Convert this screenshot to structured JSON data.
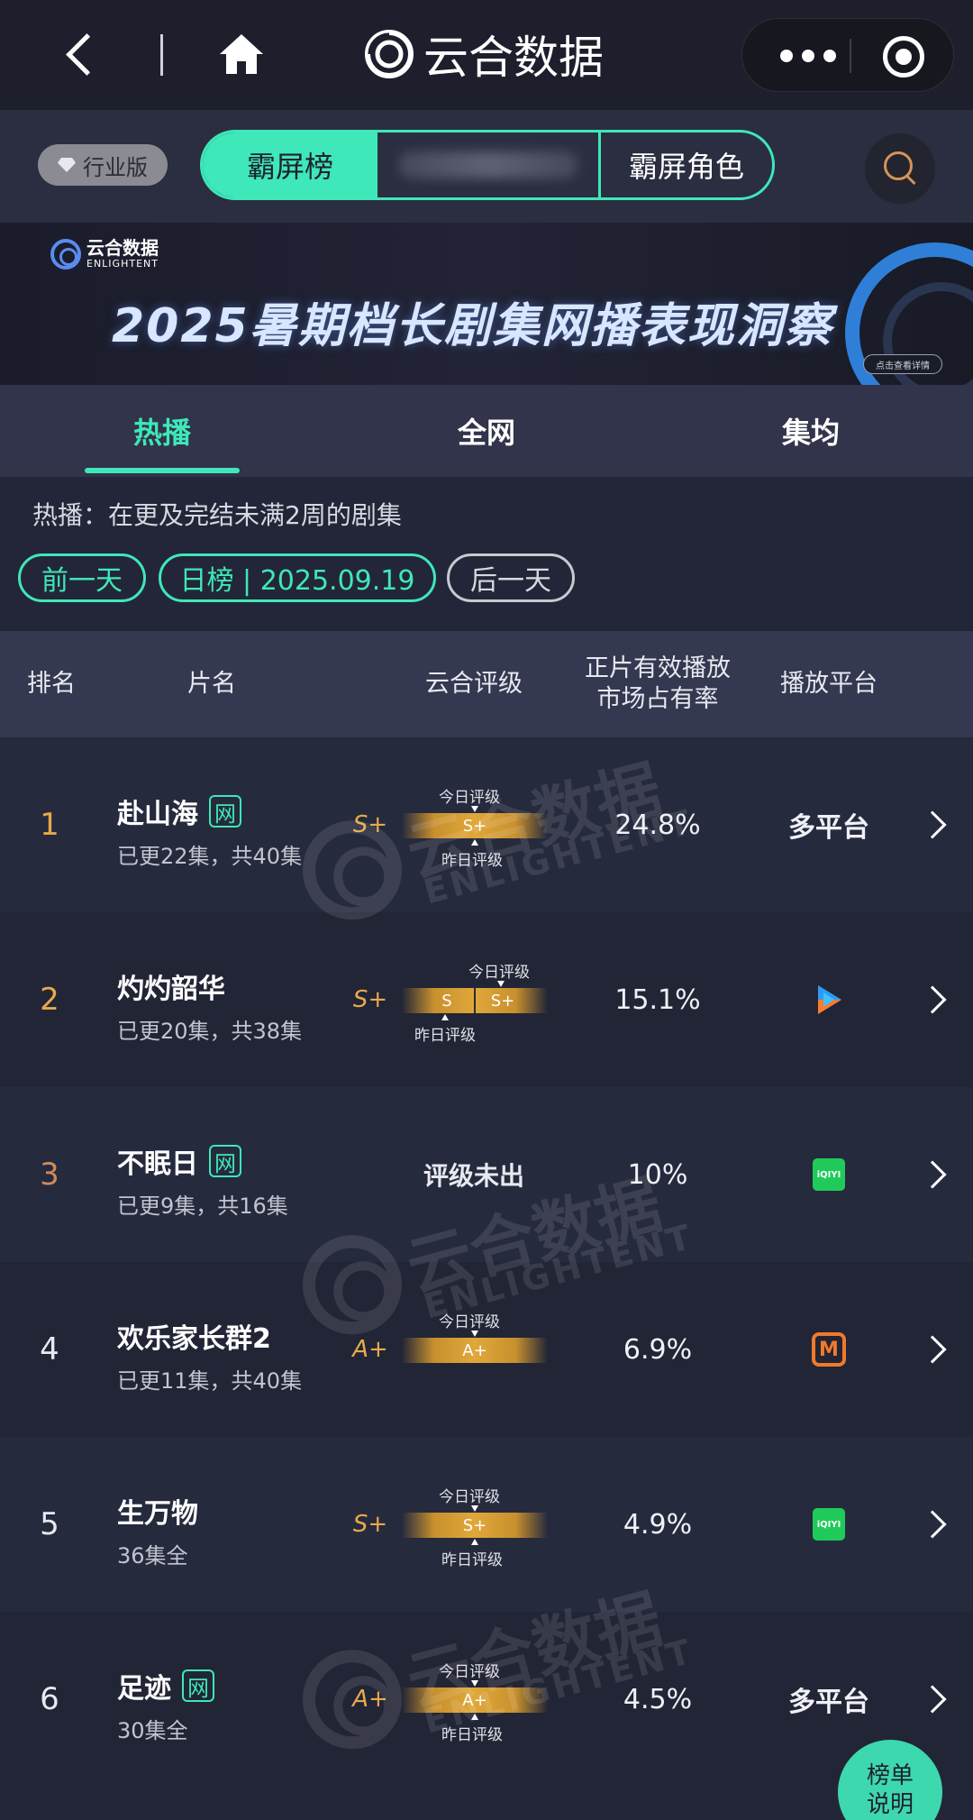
{
  "nav": {
    "title": "云合数据",
    "icons": [
      "back-icon",
      "home-icon",
      "more-icon",
      "close-icon"
    ]
  },
  "subhead": {
    "edition": "行业版",
    "segments": [
      "霸屏榜",
      "",
      "霸屏角色"
    ],
    "search_icon": "search-icon"
  },
  "banner": {
    "logo_text": "云合数据",
    "logo_sub": "ENLIGHTENT",
    "title": "2025暑期档长剧集网播表现洞察",
    "cta": "点击查看详情"
  },
  "tabs": [
    "热播",
    "全网",
    "集均"
  ],
  "description": "热播：在更及完结未满2周的剧集",
  "dates": {
    "prev": "前一天",
    "current": "日榜 | 2025.09.19",
    "next": "后一天"
  },
  "table": {
    "headers": [
      "排名",
      "片名",
      "云合评级",
      "正片有效播放\n市场占有率",
      "播放平台"
    ],
    "rows": [
      {
        "rank": "1",
        "title": "赴山海",
        "tag": "网",
        "episodes": "已更22集，共40集",
        "grade": "S+",
        "today_label": "今日评级",
        "yesterday_label": "昨日评级",
        "today": "S+",
        "yesterday": "",
        "share": "24.8%",
        "platform": "多平台",
        "platform_icon": ""
      },
      {
        "rank": "2",
        "title": "灼灼韶华",
        "tag": "",
        "episodes": "已更20集，共38集",
        "grade": "S+",
        "today_label": "今日评级",
        "yesterday_label": "昨日评级",
        "today": "S+",
        "yesterday": "S",
        "share": "15.1%",
        "platform": "",
        "platform_icon": "tencent-video-icon"
      },
      {
        "rank": "3",
        "title": "不眠日",
        "tag": "网",
        "episodes": "已更9集，共16集",
        "grade": "",
        "no_grade": "评级未出",
        "share": "10%",
        "platform": "",
        "platform_icon": "iqiyi-icon"
      },
      {
        "rank": "4",
        "title": "欢乐家长群2",
        "tag": "",
        "episodes": "已更11集，共40集",
        "grade": "A+",
        "today_label": "今日评级",
        "today": "A+",
        "share": "6.9%",
        "platform": "",
        "platform_icon": "mango-tv-icon"
      },
      {
        "rank": "5",
        "title": "生万物",
        "tag": "",
        "episodes": "36集全",
        "grade": "S+",
        "today_label": "今日评级",
        "yesterday_label": "昨日评级",
        "today": "S+",
        "share": "4.9%",
        "platform": "",
        "platform_icon": "iqiyi-icon"
      },
      {
        "rank": "6",
        "title": "足迹",
        "tag": "网",
        "episodes": "30集全",
        "grade": "A+",
        "today_label": "今日评级",
        "yesterday_label": "昨日评级",
        "today": "A+",
        "share": "4.5%",
        "platform": "多平台",
        "platform_icon": ""
      }
    ]
  },
  "watermark": {
    "cn": "云合数据",
    "en": "ENLIGHTENT"
  },
  "help": {
    "line1": "榜单",
    "line2": "说明"
  },
  "colors": {
    "accent": "#3ee8b8",
    "grade": "#e8a94a",
    "rank_top": "#e8a94a",
    "bg": "#232638"
  }
}
